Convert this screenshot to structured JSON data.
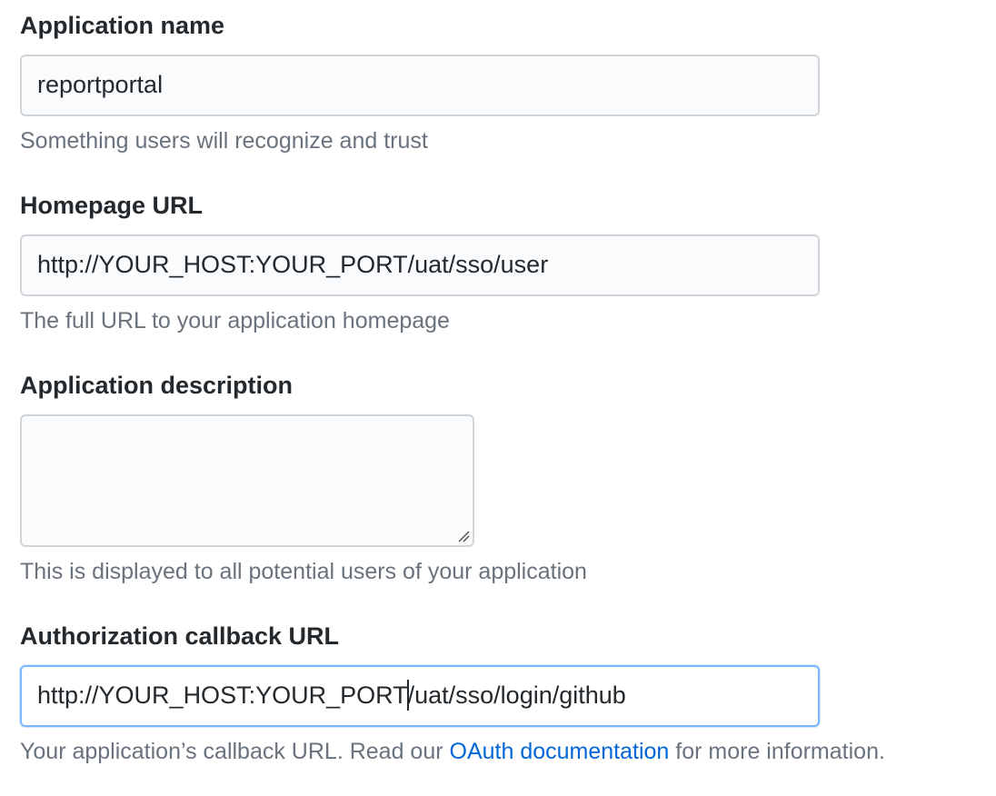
{
  "form": {
    "app_name": {
      "label": "Application name",
      "value": "reportportal",
      "note": "Something users will recognize and trust"
    },
    "homepage_url": {
      "label": "Homepage URL",
      "value": "http://YOUR_HOST:YOUR_PORT/uat/sso/user",
      "note": "The full URL to your application homepage"
    },
    "description": {
      "label": "Application description",
      "value": "",
      "note": "This is displayed to all potential users of your application"
    },
    "callback_url": {
      "label": "Authorization callback URL",
      "value_before_caret": "http://YOUR_HOST:YOUR_PORT",
      "value_after_caret": "/uat/sso/login/github",
      "note_prefix": "Your application’s callback URL. Read our ",
      "note_link": "OAuth documentation",
      "note_suffix": " for more information."
    }
  },
  "colors": {
    "text": "#24292e",
    "muted": "#6a737d",
    "link": "#0366d6",
    "field_bg": "#fafbfc",
    "field_border": "#d1d5da",
    "focus_border": "#79b8ff"
  },
  "icons": {
    "resize": "resize-grip-icon"
  }
}
